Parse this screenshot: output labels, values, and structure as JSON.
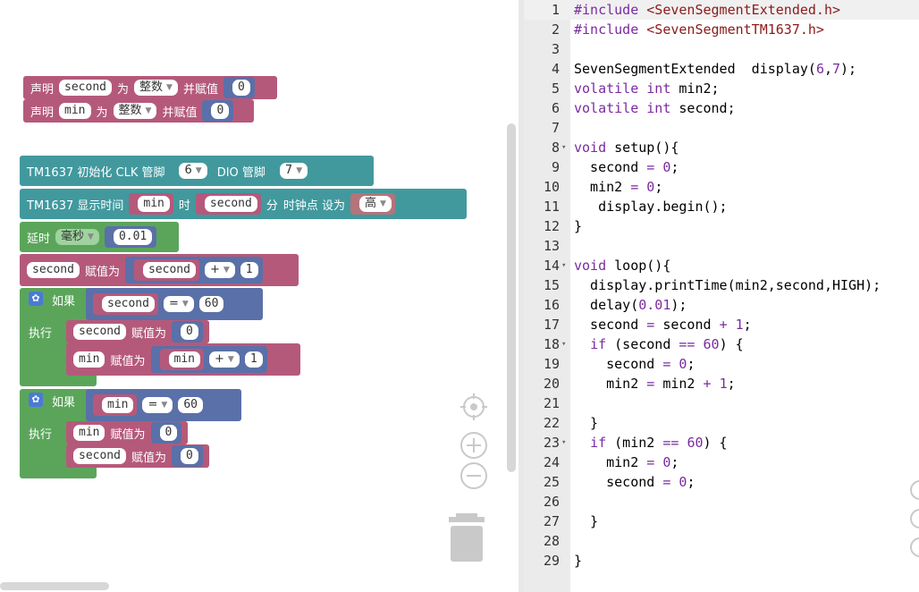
{
  "blocks": {
    "decl1": {
      "label": "声明",
      "var": "second",
      "as": "为",
      "type": "整数",
      "assign": "并赋值",
      "value": "0"
    },
    "decl2": {
      "label": "声明",
      "var": "min",
      "as": "为",
      "type": "整数",
      "assign": "并赋值",
      "value": "0"
    },
    "tm_init": {
      "label": "TM1637 初始化 CLK 管脚",
      "clk": "6",
      "dio_label": "DIO 管脚",
      "dio": "7"
    },
    "tm_show": {
      "label": "TM1637 显示时间",
      "var1": "min",
      "hour": "时",
      "var2": "second",
      "minute": "分",
      "colon": "时钟点 设为",
      "level": "高"
    },
    "delay": {
      "label": "延时",
      "unit": "毫秒",
      "value": "0.01"
    },
    "assign_sec": {
      "var": "second",
      "label": "赋值为",
      "operand": "second",
      "op": "+",
      "value": "1"
    },
    "if1": {
      "if_label": "如果",
      "do_label": "执行",
      "var": "second",
      "op": "=",
      "value": "60",
      "body1": {
        "var": "second",
        "label": "赋值为",
        "value": "0"
      },
      "body2": {
        "var": "min",
        "label": "赋值为",
        "operand": "min",
        "op": "+",
        "value": "1"
      }
    },
    "if2": {
      "if_label": "如果",
      "do_label": "执行",
      "var": "min",
      "op": "=",
      "value": "60",
      "body1": {
        "var": "min",
        "label": "赋值为",
        "value": "0"
      },
      "body2": {
        "var": "second",
        "label": "赋值为",
        "value": "0"
      }
    }
  },
  "icons": [
    "gear-icon",
    "target-icon",
    "zoom-in-icon",
    "zoom-out-icon",
    "trash-icon"
  ],
  "code_lines": [
    {
      "n": "1",
      "fold": "",
      "html": "<span class='pp'>#include</span> <span class='str'>&lt;SevenSegmentExtended.h&gt;</span>"
    },
    {
      "n": "2",
      "fold": "",
      "html": "<span class='pp'>#include</span> <span class='str'>&lt;SevenSegmentTM1637.h&gt;</span>"
    },
    {
      "n": "3",
      "fold": "",
      "html": ""
    },
    {
      "n": "4",
      "fold": "",
      "html": "SevenSegmentExtended  display(<span class='nm'>6</span>,<span class='nm'>7</span>);"
    },
    {
      "n": "5",
      "fold": "",
      "html": "<span class='kw'>volatile</span> <span class='kw'>int</span> min2;"
    },
    {
      "n": "6",
      "fold": "",
      "html": "<span class='kw'>volatile</span> <span class='kw'>int</span> second;"
    },
    {
      "n": "7",
      "fold": "",
      "html": ""
    },
    {
      "n": "8",
      "fold": "▾",
      "html": "<span class='kw'>void</span> setup(){"
    },
    {
      "n": "9",
      "fold": "",
      "html": "  second <span class='op'>=</span> <span class='nm'>0</span>;"
    },
    {
      "n": "10",
      "fold": "",
      "html": "  min2 <span class='op'>=</span> <span class='nm'>0</span>;"
    },
    {
      "n": "11",
      "fold": "",
      "html": "   display.begin();"
    },
    {
      "n": "12",
      "fold": "",
      "html": "}"
    },
    {
      "n": "13",
      "fold": "",
      "html": ""
    },
    {
      "n": "14",
      "fold": "▾",
      "html": "<span class='kw'>void</span> loop(){"
    },
    {
      "n": "15",
      "fold": "",
      "html": "  display.printTime(min2,second,HIGH);"
    },
    {
      "n": "16",
      "fold": "",
      "html": "  delay(<span class='nm'>0.01</span>);"
    },
    {
      "n": "17",
      "fold": "",
      "html": "  second <span class='op'>=</span> second <span class='op'>+</span> <span class='nm'>1</span>;"
    },
    {
      "n": "18",
      "fold": "▾",
      "html": "  <span class='kw'>if</span> (second <span class='op'>==</span> <span class='nm'>60</span>) {"
    },
    {
      "n": "19",
      "fold": "",
      "html": "    second <span class='op'>=</span> <span class='nm'>0</span>;"
    },
    {
      "n": "20",
      "fold": "",
      "html": "    min2 <span class='op'>=</span> min2 <span class='op'>+</span> <span class='nm'>1</span>;"
    },
    {
      "n": "21",
      "fold": "",
      "html": ""
    },
    {
      "n": "22",
      "fold": "",
      "html": "  }"
    },
    {
      "n": "23",
      "fold": "▾",
      "html": "  <span class='kw'>if</span> (min2 <span class='op'>==</span> <span class='nm'>60</span>) {"
    },
    {
      "n": "24",
      "fold": "",
      "html": "    min2 <span class='op'>=</span> <span class='nm'>0</span>;"
    },
    {
      "n": "25",
      "fold": "",
      "html": "    second <span class='op'>=</span> <span class='nm'>0</span>;"
    },
    {
      "n": "26",
      "fold": "",
      "html": ""
    },
    {
      "n": "27",
      "fold": "",
      "html": "  }"
    },
    {
      "n": "28",
      "fold": "",
      "html": ""
    },
    {
      "n": "29",
      "fold": "",
      "html": "}"
    }
  ],
  "active_line": "1"
}
